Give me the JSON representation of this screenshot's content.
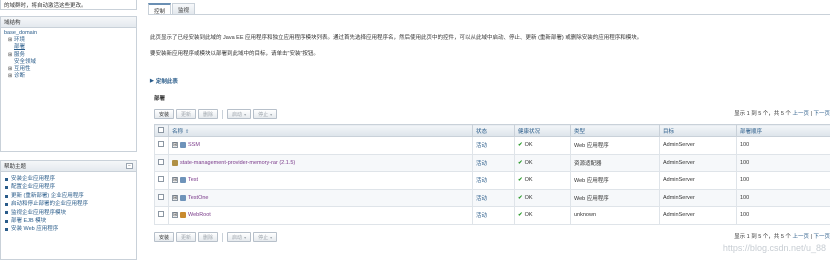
{
  "notice": {
    "text": "的域群时，将自动激活这些更改。"
  },
  "domain_structure": {
    "title": "域结构",
    "root": "base_domain",
    "nodes": [
      {
        "label": "环境",
        "level": 1,
        "expander": "⊞"
      },
      {
        "label": "部署",
        "level": 1,
        "expander": "",
        "selected": true
      },
      {
        "label": "服务",
        "level": 1,
        "expander": "⊞"
      },
      {
        "label": "安全领域",
        "level": 2,
        "expander": ""
      },
      {
        "label": "互用性",
        "level": 1,
        "expander": "⊞"
      },
      {
        "label": "诊断",
        "level": 1,
        "expander": "⊞"
      }
    ]
  },
  "help": {
    "title": "帮助主题",
    "minimize": "−",
    "items": [
      "安装企业应用程序",
      "配置企业应用程序",
      "更新 (重新部署) 企业应用程序",
      "启动和停止部署的企业应用程序",
      "监视企业应用程序模块",
      "部署 EJB 模块",
      "安装 Web 应用程序"
    ]
  },
  "tabs": [
    {
      "label": "控制",
      "active": true
    },
    {
      "label": "监视",
      "active": false
    }
  ],
  "description": {
    "line1": "此页显示了已经安装到此域的 Java EE 应用程序和独立应用程序模块列表。通过首先选择应用程序名，然后使用此页中的控件，可以从此域中启动、停止、更新 (重新部署) 或删除安装的应用程序和模块。",
    "line2": "要安装新应用程序或模块以部署到此域中的目标，请单击\"安装\"按钮。"
  },
  "section": {
    "title": "定制此表"
  },
  "table": {
    "title": "部署",
    "toolbar": {
      "install": "安装",
      "update": "更新",
      "delete": "删除",
      "start": "启动",
      "stop": "停止"
    },
    "pager_top": {
      "text": "显示 1 到 5 个，共 5 个",
      "prev": "上一页",
      "next": "下一页"
    },
    "pager_bottom": {
      "text": "显示 1 到 5 个，共 5 个",
      "prev": "上一页",
      "next": "下一页"
    },
    "columns": [
      "名称",
      "状态",
      "健康状况",
      "类型",
      "目标",
      "部署顺序"
    ],
    "rows": [
      {
        "name": "SSM",
        "state": "活动",
        "health": "OK",
        "type": "Web 应用程序",
        "target": "AdminServer",
        "order": "100",
        "expander": "⊞",
        "icon": "web-app-icon"
      },
      {
        "name": "state-management-provider-memory-rar (2.1.5)",
        "state": "活动",
        "health": "OK",
        "type": "资源适配器",
        "target": "AdminServer",
        "order": "100",
        "expander": "",
        "icon": "library-icon"
      },
      {
        "name": "Test",
        "state": "活动",
        "health": "OK",
        "type": "Web 应用程序",
        "target": "AdminServer",
        "order": "100",
        "expander": "⊞",
        "icon": "web-app-icon"
      },
      {
        "name": "TestOne",
        "state": "活动",
        "health": "OK",
        "type": "Web 应用程序",
        "target": "AdminServer",
        "order": "100",
        "expander": "⊞",
        "icon": "web-app-icon"
      },
      {
        "name": "WebRoot",
        "state": "活动",
        "health": "OK",
        "type": "unknown",
        "target": "AdminServer",
        "order": "100",
        "expander": "⊞",
        "icon": "folder-icon"
      }
    ]
  },
  "watermark": {
    "text": "https://blog.csdn.net/u_88"
  },
  "colors": {
    "link": "#2a5c8a",
    "ok": "#2e9b2e",
    "border": "#c9d1d9"
  }
}
